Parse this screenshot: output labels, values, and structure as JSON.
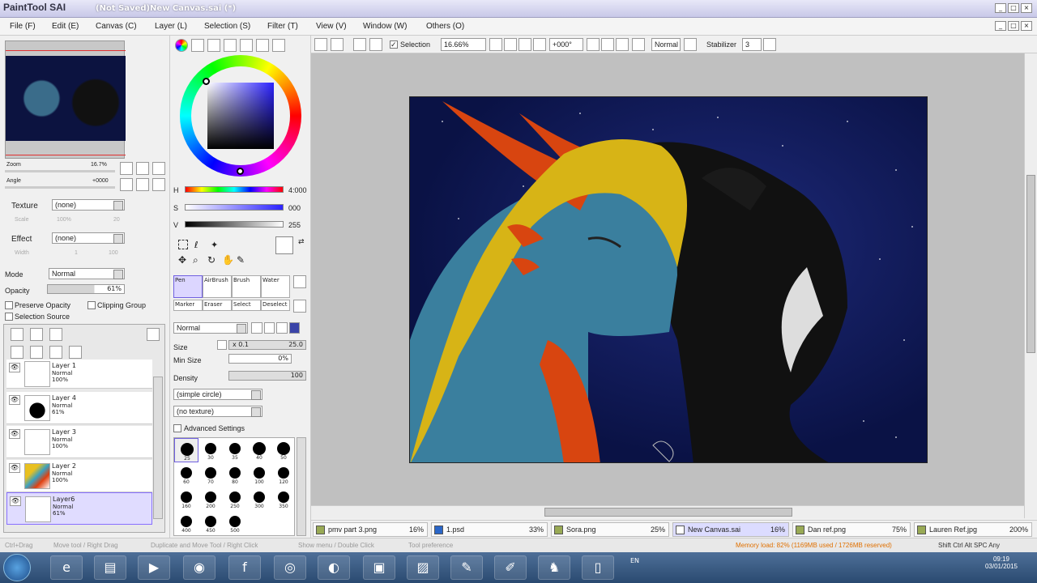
{
  "app": {
    "logo": "PaintTool SAI",
    "title": "(Not Saved)New Canvas.sai (*)"
  },
  "menu": [
    "File (F)",
    "Edit (E)",
    "Canvas (C)",
    "Layer (L)",
    "Selection (S)",
    "Filter (T)",
    "View (V)",
    "Window (W)",
    "Others (O)"
  ],
  "toolbar": {
    "selection_label": "Selection",
    "zoom": "16.66%",
    "angle": "+000°",
    "mode": "Normal",
    "stabilizer_label": "Stabilizer",
    "stabilizer": "3"
  },
  "navigator": {
    "zoom_label": "Zoom",
    "zoom_value": "16.7%",
    "angle_label": "Angle",
    "angle_value": "+0000"
  },
  "texture": {
    "label": "Texture",
    "value": "(none)",
    "scale_label": "Scale",
    "scale_value": "100%",
    "scale_num": "20"
  },
  "effect": {
    "label": "Effect",
    "value": "(none)",
    "width_label": "Width",
    "width_value": "1",
    "width_num": "100"
  },
  "layer_props": {
    "mode_label": "Mode",
    "mode_value": "Normal",
    "opacity_label": "Opacity",
    "opacity_value": "61%",
    "preserve_opacity": "Preserve Opacity",
    "clipping_group": "Clipping Group",
    "selection_source": "Selection Source"
  },
  "layers": [
    {
      "name": "Layer 1",
      "mode": "Normal",
      "opacity": "100%"
    },
    {
      "name": "Layer 4",
      "mode": "Normal",
      "opacity": "61%"
    },
    {
      "name": "Layer 3",
      "mode": "Normal",
      "opacity": "100%"
    },
    {
      "name": "Layer 2",
      "mode": "Normal",
      "opacity": "100%"
    },
    {
      "name": "Layer6",
      "mode": "Normal",
      "opacity": "61%"
    }
  ],
  "color": {
    "h_label": "H",
    "h_value": "4:000",
    "s_label": "S",
    "s_value": "000",
    "v_label": "V",
    "v_value": "255"
  },
  "tools": [
    {
      "label": "Pen"
    },
    {
      "label": "AirBrush"
    },
    {
      "label": "Brush"
    },
    {
      "label": "Water"
    },
    {
      "label": "Marker"
    },
    {
      "label": "Eraser"
    },
    {
      "label": "Select"
    },
    {
      "label": "Deselect"
    }
  ],
  "brush": {
    "mode": "Normal",
    "size_label": "Size",
    "size_mult": "x 0.1",
    "size_value": "25.0",
    "minsize_label": "Min Size",
    "minsize_value": "0%",
    "density_label": "Density",
    "density_value": "100",
    "shape": "(simple circle)",
    "texture": "(no texture)",
    "advanced": "Advanced Settings"
  },
  "brush_sizes": [
    "25",
    "30",
    "35",
    "40",
    "50",
    "60",
    "70",
    "80",
    "100",
    "120",
    "160",
    "200",
    "250",
    "300",
    "350",
    "400",
    "450",
    "500"
  ],
  "doc_tabs": [
    {
      "name": "pmv part 3.png",
      "pct": "16%"
    },
    {
      "name": "1.psd",
      "pct": "33%"
    },
    {
      "name": "Sora.png",
      "pct": "25%"
    },
    {
      "name": "New Canvas.sai",
      "pct": "16%"
    },
    {
      "name": "Dan ref.png",
      "pct": "75%"
    },
    {
      "name": "Lauren Ref.jpg",
      "pct": "200%"
    }
  ],
  "status": {
    "hint1": "Ctrl+Drag",
    "hint2": "Move tool / Right Drag",
    "hint3": "Duplicate and Move Tool / Right Click",
    "hint4": "Show menu / Double Click",
    "hint5": "Tool preference",
    "memory": "Memory load: 82% (1169MB used / 1726MB reserved)",
    "keys": "Shift Ctrl Alt SPC Any"
  },
  "taskbar": {
    "lang": "EN",
    "time": "09:19",
    "date": "03/01/2015"
  }
}
